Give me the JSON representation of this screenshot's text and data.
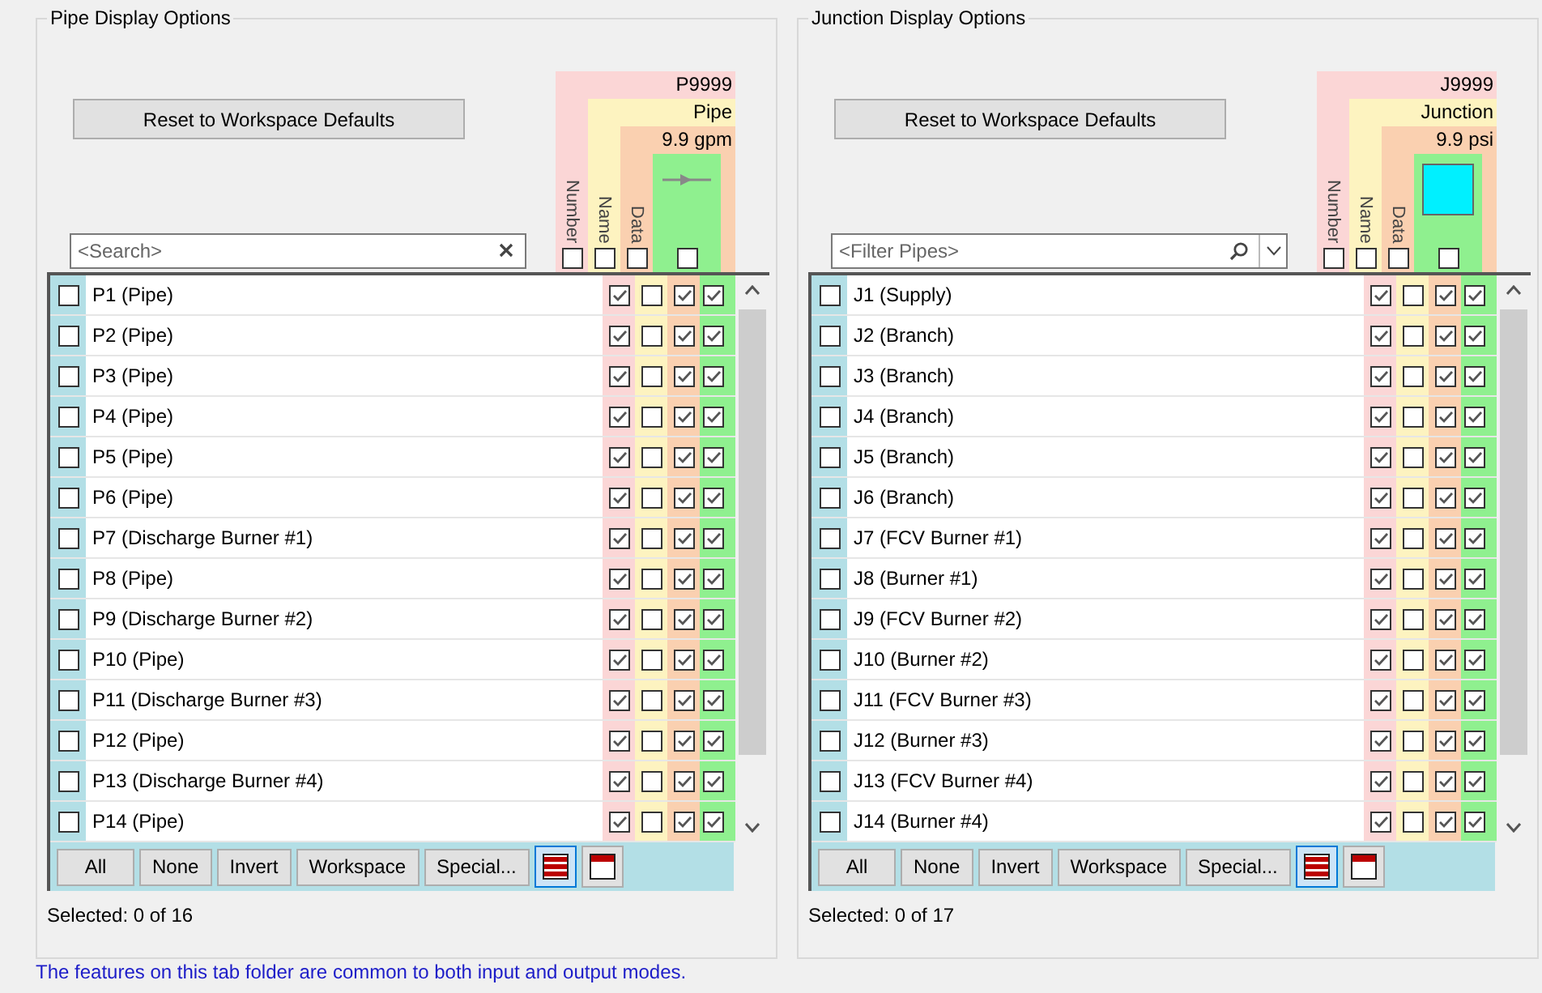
{
  "panels": [
    {
      "title": "Pipe Display Options",
      "reset_label": "Reset to Workspace Defaults",
      "search": {
        "kind": "clear",
        "placeholder": "<Search>"
      },
      "header": {
        "number": "P9999",
        "name": "Pipe",
        "data": "9.9 gpm",
        "symbol": {
          "kind": "pipe"
        },
        "labels": [
          "Number",
          "Name",
          "Data"
        ],
        "checks": [
          false,
          false,
          false,
          false
        ]
      },
      "rows": [
        {
          "label": "P1 (Pipe)",
          "checked": false,
          "columns": [
            true,
            false,
            true,
            true
          ]
        },
        {
          "label": "P2 (Pipe)",
          "checked": false,
          "columns": [
            true,
            false,
            true,
            true
          ]
        },
        {
          "label": "P3 (Pipe)",
          "checked": false,
          "columns": [
            true,
            false,
            true,
            true
          ]
        },
        {
          "label": "P4 (Pipe)",
          "checked": false,
          "columns": [
            true,
            false,
            true,
            true
          ]
        },
        {
          "label": "P5 (Pipe)",
          "checked": false,
          "columns": [
            true,
            false,
            true,
            true
          ]
        },
        {
          "label": "P6 (Pipe)",
          "checked": false,
          "columns": [
            true,
            false,
            true,
            true
          ]
        },
        {
          "label": "P7 (Discharge Burner #1)",
          "checked": false,
          "columns": [
            true,
            false,
            true,
            true
          ]
        },
        {
          "label": "P8 (Pipe)",
          "checked": false,
          "columns": [
            true,
            false,
            true,
            true
          ]
        },
        {
          "label": "P9 (Discharge Burner #2)",
          "checked": false,
          "columns": [
            true,
            false,
            true,
            true
          ]
        },
        {
          "label": "P10 (Pipe)",
          "checked": false,
          "columns": [
            true,
            false,
            true,
            true
          ]
        },
        {
          "label": "P11 (Discharge Burner #3)",
          "checked": false,
          "columns": [
            true,
            false,
            true,
            true
          ]
        },
        {
          "label": "P12 (Pipe)",
          "checked": false,
          "columns": [
            true,
            false,
            true,
            true
          ]
        },
        {
          "label": "P13 (Discharge Burner #4)",
          "checked": false,
          "columns": [
            true,
            false,
            true,
            true
          ]
        },
        {
          "label": "P14 (Pipe)",
          "checked": false,
          "columns": [
            true,
            false,
            true,
            true
          ]
        }
      ],
      "buttons": [
        "All",
        "None",
        "Invert",
        "Workspace",
        "Special..."
      ],
      "view_buttons": [
        {
          "kind": "rows",
          "selected": true
        },
        {
          "kind": "window",
          "selected": false
        }
      ],
      "status": "Selected: 0 of 16"
    },
    {
      "title": "Junction Display Options",
      "reset_label": "Reset to Workspace Defaults",
      "search": {
        "kind": "filter",
        "placeholder": "<Filter Pipes>"
      },
      "header": {
        "number": "J9999",
        "name": "Junction",
        "data": "9.9 psi",
        "symbol": {
          "kind": "junction"
        },
        "labels": [
          "Number",
          "Name",
          "Data"
        ],
        "checks": [
          false,
          false,
          false,
          false
        ]
      },
      "rows": [
        {
          "label": "J1 (Supply)",
          "checked": false,
          "columns": [
            true,
            false,
            true,
            true
          ]
        },
        {
          "label": "J2 (Branch)",
          "checked": false,
          "columns": [
            true,
            false,
            true,
            true
          ]
        },
        {
          "label": "J3 (Branch)",
          "checked": false,
          "columns": [
            true,
            false,
            true,
            true
          ]
        },
        {
          "label": "J4 (Branch)",
          "checked": false,
          "columns": [
            true,
            false,
            true,
            true
          ]
        },
        {
          "label": "J5 (Branch)",
          "checked": false,
          "columns": [
            true,
            false,
            true,
            true
          ]
        },
        {
          "label": "J6 (Branch)",
          "checked": false,
          "columns": [
            true,
            false,
            true,
            true
          ]
        },
        {
          "label": "J7 (FCV Burner #1)",
          "checked": false,
          "columns": [
            true,
            false,
            true,
            true
          ]
        },
        {
          "label": "J8 (Burner #1)",
          "checked": false,
          "columns": [
            true,
            false,
            true,
            true
          ]
        },
        {
          "label": "J9 (FCV Burner #2)",
          "checked": false,
          "columns": [
            true,
            false,
            true,
            true
          ]
        },
        {
          "label": "J10 (Burner #2)",
          "checked": false,
          "columns": [
            true,
            false,
            true,
            true
          ]
        },
        {
          "label": "J11 (FCV Burner #3)",
          "checked": false,
          "columns": [
            true,
            false,
            true,
            true
          ]
        },
        {
          "label": "J12 (Burner #3)",
          "checked": false,
          "columns": [
            true,
            false,
            true,
            true
          ]
        },
        {
          "label": "J13 (FCV Burner #4)",
          "checked": false,
          "columns": [
            true,
            false,
            true,
            true
          ]
        },
        {
          "label": "J14 (Burner #4)",
          "checked": false,
          "columns": [
            true,
            false,
            true,
            true
          ]
        }
      ],
      "buttons": [
        "All",
        "None",
        "Invert",
        "Workspace",
        "Special..."
      ],
      "view_buttons": [
        {
          "kind": "rows",
          "selected": true
        },
        {
          "kind": "window",
          "selected": false
        }
      ],
      "status": "Selected: 0 of 17"
    }
  ],
  "footer": "The features on this tab folder are common to both input and output modes."
}
